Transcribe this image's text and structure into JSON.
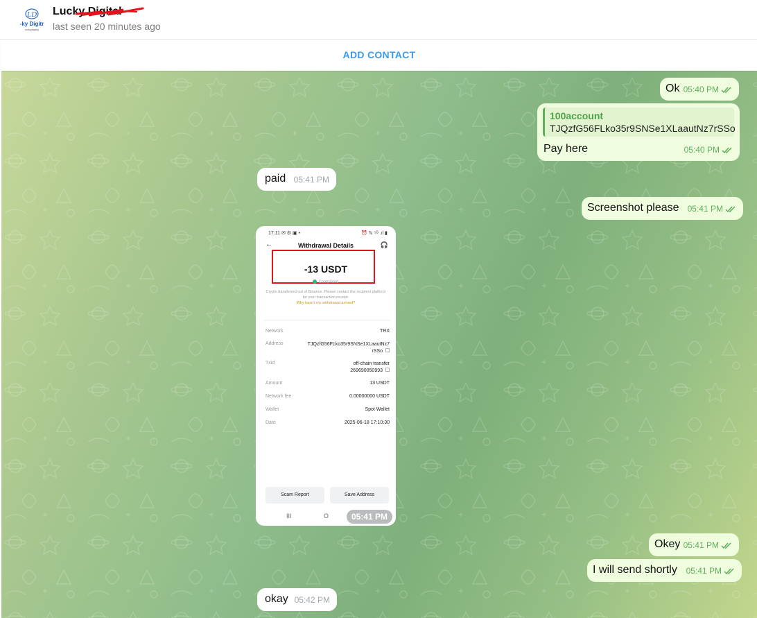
{
  "header": {
    "contact_name": "Lucky Digital",
    "last_seen": "last seen 20 minutes ago",
    "avatar_text": "-ky Digitr",
    "avatar_subtext": "luckydigital",
    "avatar_logo": "LD"
  },
  "add_contact": {
    "label": "ADD CONTACT"
  },
  "colors": {
    "accent": "#3c9ae6",
    "outgoing_bubble": "#effdde",
    "incoming_bubble": "#ffffff",
    "time_outgoing": "#5fae5c",
    "highlight_box": "#e0141c"
  },
  "messages": [
    {
      "dir": "out",
      "text": "Ok",
      "time": "05:40 PM"
    },
    {
      "dir": "out",
      "quote_name": "100account",
      "quote_text": "TJQzfG56FLko35r9SNSe1XLaautNz7rSSo",
      "text": "Pay here",
      "time": "05:40 PM"
    },
    {
      "dir": "in",
      "text": "paid",
      "time": "05:41 PM"
    },
    {
      "dir": "out",
      "text": "Screenshot please",
      "time": "05:41 PM"
    },
    {
      "dir": "in",
      "type": "photo",
      "time": "05:41 PM"
    },
    {
      "dir": "out",
      "text": "Okey",
      "time": "05:41 PM"
    },
    {
      "dir": "out",
      "text": "I will send shortly",
      "time": "05:41 PM"
    },
    {
      "dir": "in",
      "text": "okay",
      "time": "05:42 PM"
    }
  ],
  "photo": {
    "status_left": "17:11 ✉ ⚙ ▣ •",
    "status_right": "⏰ ℕ ⁵ᴳ .ıl ▮",
    "back_icon": "←",
    "help_icon": "🎧",
    "title": "Withdrawal Details",
    "amount": "-13 USDT",
    "status": "Completed",
    "note": "Crypto transferred out of Binance. Please contact the recipient platform for your transaction receipt.",
    "link": "Why hasn't my withdrawal arrived?",
    "rows": [
      {
        "key": "Network",
        "value": "TRX"
      },
      {
        "key": "Address",
        "value": "TJQzfG56FLko35r9SNSe1XLaautNz7rSSo"
      },
      {
        "key": "Txid",
        "value": "off-chain transfer 269690050993"
      },
      {
        "key": "Amount",
        "value": "13 USDT"
      },
      {
        "key": "Network fee",
        "value": "0.00000000 USDT"
      },
      {
        "key": "Wallet",
        "value": "Spot Wallet"
      },
      {
        "key": "Date",
        "value": "2025-06-18 17:10:30"
      }
    ],
    "buttons": [
      "Scam Report",
      "Save Address"
    ],
    "nav": [
      "III",
      "O"
    ]
  }
}
